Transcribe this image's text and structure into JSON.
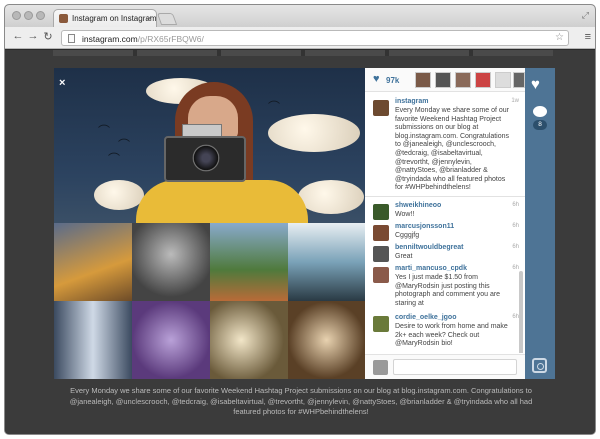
{
  "browser": {
    "tab_title": "Instagram on Instagram",
    "url_host": "instagram.com",
    "url_path": "/p/RX65rFBQW6/"
  },
  "sidebar": {
    "likes_count": "97k",
    "caption": {
      "username": "instagram",
      "time": "1w",
      "text": "Every Monday we share some of our favorite Weekend Hashtag Project submissions on our blog at blog.instagram.com. Congratulations to @janealeigh, @unclescrooch, @tedcraig, @isabeltavirtual, @trevortht, @jennylevin, @nattyStoes, @brianladder & @tryindada who all featured photos for #WHPbehindthelens!"
    },
    "comments": [
      {
        "username": "shweikhineoo",
        "text": "Wow!!",
        "time": "6h"
      },
      {
        "username": "marcusjonsson11",
        "text": "Cgggjfg",
        "time": "6h"
      },
      {
        "username": "benniltwouldbegreat",
        "text": "Great",
        "time": "6h"
      },
      {
        "username": "marti_mancuso_cpdk",
        "text": "Yes I just made $1.50 from @MaryRodsin just posting this photograph and comment you are staring at",
        "time": "6h"
      },
      {
        "username": "cordie_oelke_jgoo",
        "text": "Desire to work from home and make 2k+ each week? Check out @MaryRodsin bio!",
        "time": "6h"
      }
    ],
    "comment_placeholder": ""
  },
  "actions": {
    "comment_count": "8"
  },
  "bottom_caption": "Every Monday we share some of our favorite Weekend Hashtag Project submissions on our blog at blog.instagram.com. Congratulations to @janealeigh, @unclescrooch, @tedcraig, @isabeltavirtual, @trevortht, @jennylevin, @nattyStoes, @brianladder & @tryindada who all had featured photos for #WHPbehindthelens!",
  "icons": [
    "close-icon",
    "heart-icon",
    "comment-icon",
    "instagram-icon",
    "star-icon",
    "menu-icon",
    "back-icon",
    "forward-icon",
    "reload-icon"
  ],
  "colors": {
    "accent": "#3f729b",
    "action_strip": "#4e7495",
    "overlay_bg": "#3b3b3b"
  }
}
